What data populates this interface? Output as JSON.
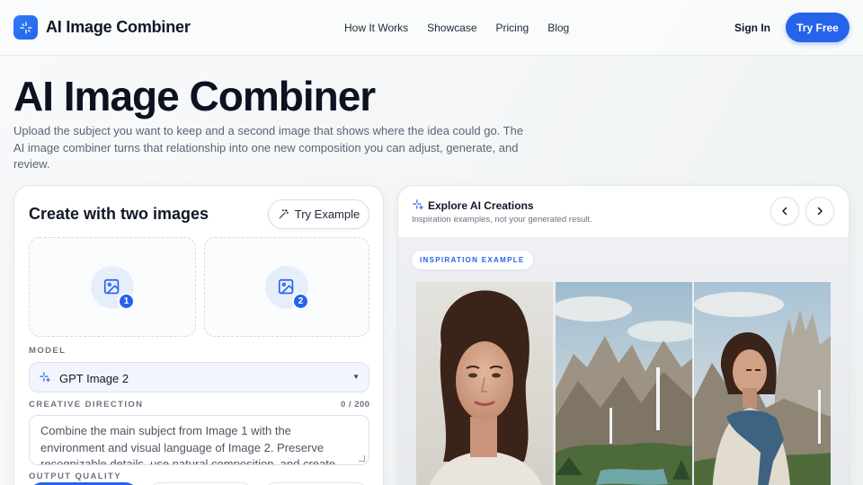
{
  "nav": {
    "brand": "AI Image Combiner",
    "links": [
      "How It Works",
      "Showcase",
      "Pricing",
      "Blog"
    ],
    "sign_in": "Sign In",
    "try_free": "Try Free"
  },
  "hero": {
    "title": "AI Image Combiner",
    "subtitle": "Upload the subject you want to keep and a second image that shows where the idea could go. The AI image combiner turns that relationship into one new composition you can adjust, generate, and review."
  },
  "create": {
    "title": "Create with two images",
    "try_example": "Try Example",
    "slot_badges": [
      "1",
      "2"
    ],
    "model_label": "MODEL",
    "model_value": "GPT Image 2",
    "direction_label": "CREATIVE DIRECTION",
    "direction_counter": "0 / 200",
    "direction_placeholder": "Combine the main subject from Image 1 with the environment and visual language of Image 2. Preserve recognizable details, use natural composition, and create one coherent new image.",
    "quality_label": "OUTPUT QUALITY"
  },
  "explore": {
    "title": "Explore AI Creations",
    "subtitle": "Inspiration examples, not your generated result.",
    "badge": "INSPIRATION EXAMPLE"
  },
  "colors": {
    "accent": "#2563eb",
    "text": "#101828",
    "muted": "#5b6474"
  },
  "icons": [
    "sparkle-logo-icon",
    "magic-wand-icon",
    "image-upload-icon",
    "sparkle-icon",
    "chevron-left-icon",
    "chevron-right-icon",
    "caret-down-icon"
  ]
}
